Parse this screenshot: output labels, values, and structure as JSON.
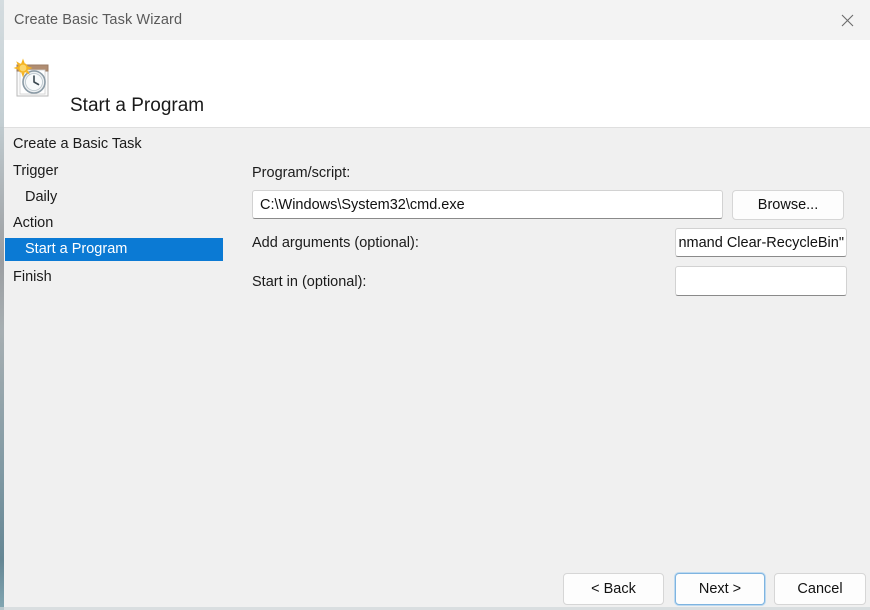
{
  "window": {
    "title": "Create Basic Task Wizard",
    "close_icon": "close-icon"
  },
  "header": {
    "icon": "task-scheduler-calendar-clock-icon",
    "title": "Start a Program"
  },
  "sidebar": {
    "items": [
      {
        "label": "Create a Basic Task",
        "level": 0,
        "selected": false
      },
      {
        "label": "Trigger",
        "level": 0,
        "selected": false
      },
      {
        "label": "Daily",
        "level": 1,
        "selected": false
      },
      {
        "label": "Action",
        "level": 0,
        "selected": false
      },
      {
        "label": "Start a Program",
        "level": 1,
        "selected": true
      },
      {
        "label": "Finish",
        "level": 0,
        "selected": false
      }
    ]
  },
  "form": {
    "program_script": {
      "label": "Program/script:",
      "value": "C:\\Windows\\System32\\cmd.exe",
      "placeholder": ""
    },
    "browse_label": "Browse...",
    "add_arguments": {
      "label": "Add arguments (optional):",
      "value": "nmand Clear-RecycleBin\"",
      "placeholder": ""
    },
    "start_in": {
      "label": "Start in (optional):",
      "value": "",
      "placeholder": ""
    }
  },
  "footer": {
    "back_label": "< Back",
    "next_label": "Next >",
    "cancel_label": "Cancel"
  },
  "colors": {
    "accent_blue": "#0b7ad4",
    "titlebar_bg": "#f3f3f3",
    "content_bg": "#f0f0f0",
    "header_bg": "#ffffff",
    "default_button_border": "#7fb4e0"
  }
}
